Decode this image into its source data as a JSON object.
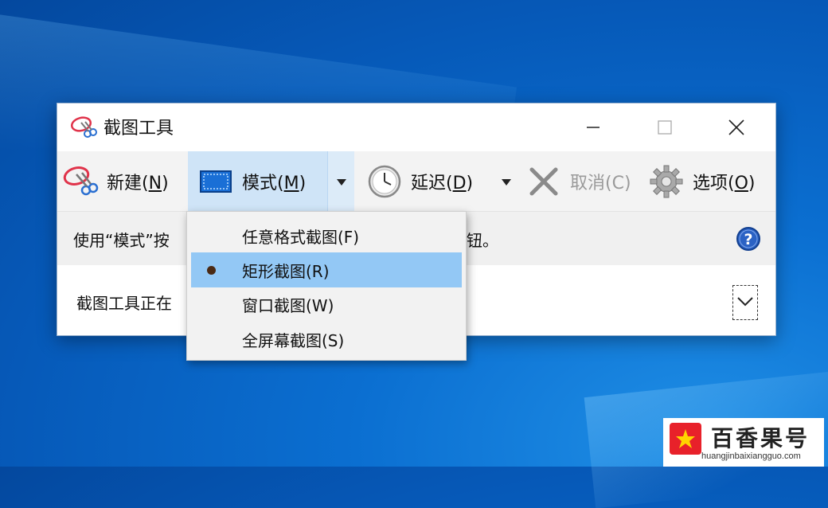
{
  "window": {
    "title": "截图工具",
    "controls": {
      "minimize": "—",
      "maximize": "☐",
      "close": "✕"
    }
  },
  "toolbar": {
    "new_label": "新建(",
    "new_key": "N",
    "new_end": ")",
    "mode_label": "模式(",
    "mode_key": "M",
    "mode_end": ")",
    "delay_label": "延迟(",
    "delay_key": "D",
    "delay_end": ")",
    "cancel_label": "取消(C)",
    "options_label": "选项(",
    "options_key": "O",
    "options_end": ")",
    "icons": {
      "new": "snipping-scissors-icon",
      "mode": "rectangle-mode-icon",
      "delay": "clock-icon",
      "cancel": "x-icon",
      "options": "gear-icon",
      "dropdown": "caret-down-icon"
    }
  },
  "infobar": {
    "text_visible": "使用“模式”按",
    "text_tail": "钮。",
    "help_icon": "help-icon"
  },
  "statusbar": {
    "text_visible": "截图工具正在",
    "expand_icon": "chevron-down-icon"
  },
  "mode_menu": {
    "items": [
      {
        "label": "任意格式截图(F)",
        "selected": false
      },
      {
        "label": "矩形截图(R)",
        "selected": true
      },
      {
        "label": "窗口截图(W)",
        "selected": false
      },
      {
        "label": "全屏幕截图(S)",
        "selected": false
      }
    ]
  },
  "watermark": {
    "title": "百香果号",
    "url": "huangjinbaixiangguo.com"
  },
  "colors": {
    "desktop": "#0b6fd1",
    "menu_highlight": "#93c8f5",
    "mode_button_bg": "#cfe4f7",
    "help_blue": "#1f5fbf",
    "watermark_red": "#e8212a"
  }
}
